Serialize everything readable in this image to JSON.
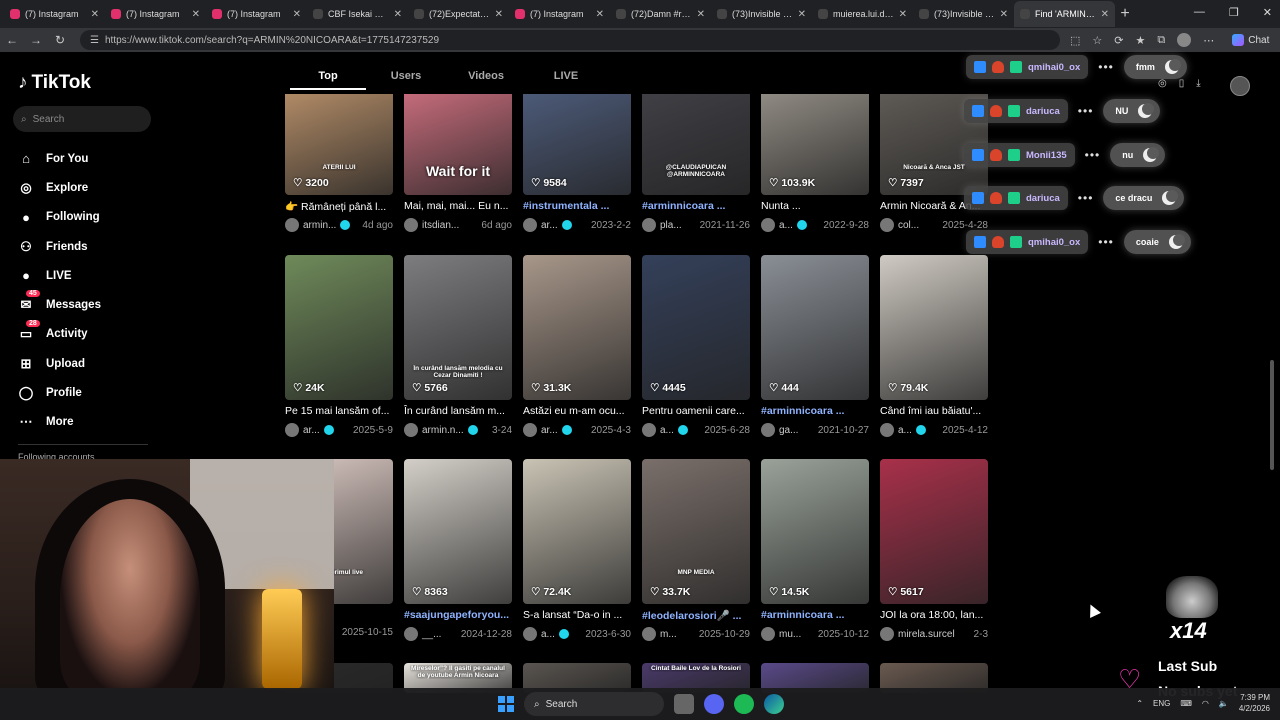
{
  "browser": {
    "tabs": [
      {
        "label": "(7) Instagram",
        "color": "#e1306c"
      },
      {
        "label": "(7) Instagram",
        "color": "#e1306c"
      },
      {
        "label": "(7) Instagram",
        "color": "#e1306c"
      },
      {
        "label": "CBF Isekai Conve",
        "color": "#444"
      },
      {
        "label": "(72)Expectation v",
        "color": "#444"
      },
      {
        "label": "(7) Instagram",
        "color": "#e1306c"
      },
      {
        "label": "(72)Damn #reside",
        "color": "#444"
      },
      {
        "label": "(73)Invisible Dang",
        "color": "#444"
      },
      {
        "label": "muierea.lui.dany",
        "color": "#444"
      },
      {
        "label": "(73)Invisible Dang",
        "color": "#444"
      },
      {
        "label": "Find 'ARMIN NICO",
        "color": "#444",
        "active": true
      }
    ],
    "url": "https://www.tiktok.com/search?q=ARMIN%20NICOARA&t=1775147237529",
    "chat_label": "Chat"
  },
  "tiktok": {
    "logo": "TikTok",
    "search_placeholder": "Search",
    "nav": [
      {
        "label": "For You",
        "icon": "home-icon"
      },
      {
        "label": "Explore",
        "icon": "compass-icon"
      },
      {
        "label": "Following",
        "icon": "following-avatar-icon"
      },
      {
        "label": "Friends",
        "icon": "friends-icon"
      },
      {
        "label": "LIVE",
        "icon": "live-icon"
      },
      {
        "label": "Messages",
        "icon": "messages-icon",
        "badge": "45"
      },
      {
        "label": "Activity",
        "icon": "activity-icon",
        "badge": "28"
      },
      {
        "label": "Upload",
        "icon": "upload-icon"
      },
      {
        "label": "Profile",
        "icon": "profile-icon"
      },
      {
        "label": "More",
        "icon": "more-icon"
      }
    ],
    "following_accounts": "Following accounts",
    "tabs": [
      "Top",
      "Users",
      "Videos",
      "LIVE"
    ],
    "rows": [
      [
        {
          "likes": "3200",
          "caption": "👉 Rămâneți până l...",
          "author": "armin...",
          "verified": true,
          "date": "4d ago",
          "tag": false,
          "thumb": "#b08a66",
          "overlay": "ATERII LUI"
        },
        {
          "likes": "",
          "caption": "Mai, mai, mai... Eu n...",
          "author": "itsdian...",
          "verified": false,
          "date": "6d ago",
          "tag": false,
          "thumb": "#c46b7a",
          "overlay": "Wait for it"
        },
        {
          "likes": "9584",
          "caption": "#instrumentala ...",
          "author": "ar...",
          "verified": true,
          "date": "2023-2-2",
          "tag": true,
          "thumb": "#4c5a78",
          "overlay": ""
        },
        {
          "likes": "",
          "caption": "#arminnicoara ...",
          "author": "pla...",
          "verified": false,
          "date": "2021-11-26",
          "tag": true,
          "thumb": "#3f3f45",
          "overlay": "@CLAUDIAPUICAN @ARMINNICOARA"
        },
        {
          "likes": "103.9K",
          "caption": "Nunta ...",
          "author": "a...",
          "verified": true,
          "date": "2022-9-28",
          "tag": false,
          "thumb": "#8f8a82",
          "overlay": ""
        },
        {
          "likes": "7397",
          "caption": "Armin Nicoară & An...",
          "author": "col...",
          "verified": false,
          "date": "2025-4-28",
          "tag": false,
          "thumb": "#5e5a55",
          "overlay": "Nicoară & Anca JST"
        }
      ],
      [
        {
          "likes": "24K",
          "caption": "Pe 15 mai lansăm of...",
          "author": "ar...",
          "verified": true,
          "date": "2025-5-9",
          "tag": false,
          "thumb": "#6f8a5a",
          "overlay": ""
        },
        {
          "likes": "5766",
          "caption": "În curând lansăm m...",
          "author": "armin.n...",
          "verified": true,
          "date": "3-24",
          "tag": false,
          "thumb": "#7d7d80",
          "overlay": "În curând lansăm melodia cu Cezar Dinamiti !"
        },
        {
          "likes": "31.3K",
          "caption": "Astăzi eu m-am ocu...",
          "author": "ar...",
          "verified": true,
          "date": "2025-4-3",
          "tag": false,
          "thumb": "#a8978a",
          "overlay": ""
        },
        {
          "likes": "4445",
          "caption": "Pentru oamenii care...",
          "author": "a...",
          "verified": true,
          "date": "2025-6-28",
          "tag": false,
          "thumb": "#34405a",
          "overlay": ""
        },
        {
          "likes": "444",
          "caption": "#arminnicoara ...",
          "author": "ga...",
          "verified": false,
          "date": "2021-10-27",
          "tag": true,
          "thumb": "#8a8f96",
          "overlay": ""
        },
        {
          "likes": "79.4K",
          "caption": "Când îmi iau băiatu'...",
          "author": "a...",
          "verified": true,
          "date": "2025-4-12",
          "tag": false,
          "thumb": "#cfcac2",
          "overlay": ""
        }
      ],
      [
        {
          "likes": "",
          "caption": "",
          "author": "",
          "verified": false,
          "date": "2025-10-15",
          "tag": false,
          "thumb": "#d8c6c0",
          "overlay": "oara primul live"
        },
        {
          "likes": "8363",
          "caption": "#saajungapeforyou...",
          "author": "__...",
          "verified": false,
          "date": "2024-12-28",
          "tag": true,
          "thumb": "#d3cfc8",
          "overlay": ""
        },
        {
          "likes": "72.4K",
          "caption": "S-a lansat “Da-o in ...",
          "author": "a...",
          "verified": true,
          "date": "2023-6-30",
          "tag": false,
          "thumb": "#c9c3b4",
          "overlay": ""
        },
        {
          "likes": "33.7K",
          "caption": "#leodelarosiori🎤 ...",
          "author": "m...",
          "verified": false,
          "date": "2025-10-29",
          "tag": true,
          "thumb": "#7a6f6a",
          "overlay": "MNP MEDIA"
        },
        {
          "likes": "14.5K",
          "caption": "#arminnicoara ...",
          "author": "mu...",
          "verified": false,
          "date": "2025-10-12",
          "tag": true,
          "thumb": "#9aa29a",
          "overlay": ""
        },
        {
          "likes": "5617",
          "caption": "JOI la ora 18:00, lan...",
          "author": "mirela.surcel",
          "verified": false,
          "date": "2-3",
          "tag": false,
          "thumb": "#a8304a",
          "overlay": ""
        }
      ],
      [
        {
          "thumb": "#2a2a2a",
          "overlay": ""
        },
        {
          "thumb": "#e6e2dc",
          "overlay": "Mireselor”? Il gasiti pe canalul de youtube Armin Nicoara"
        },
        {
          "thumb": "#5a5550",
          "overlay": ""
        },
        {
          "thumb": "#4a3a6a",
          "overlay": "Cintat Baile Lov de la Rosiori"
        },
        {
          "thumb": "#5a4a8a",
          "overlay": ""
        },
        {
          "thumb": "#6a5a50",
          "overlay": ""
        }
      ]
    ]
  },
  "stream_chat": [
    {
      "user": "qmihai0_ox",
      "msg": "fmm"
    },
    {
      "user": "dariuca",
      "msg": "NU"
    },
    {
      "user": "Monii135",
      "msg": "nu"
    },
    {
      "user": "dariuca",
      "msg": "ce dracu"
    },
    {
      "user": "qmihai0_ox",
      "msg": "coaie"
    }
  ],
  "sub_overlay": {
    "multiplier": "x14",
    "last_sub": "Last Sub",
    "value": "No subs yet"
  },
  "taskbar": {
    "search": "Search",
    "lang": "ENG",
    "time": "7:39 PM",
    "date": "4/2/2026"
  }
}
